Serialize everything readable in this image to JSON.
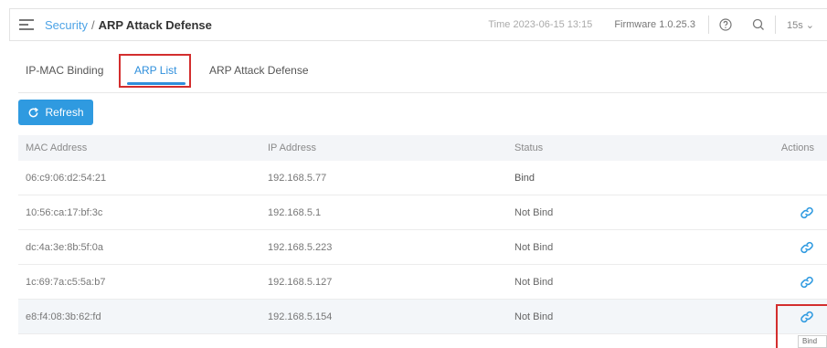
{
  "header": {
    "breadcrumb_parent": "Security",
    "breadcrumb_separator": "/",
    "breadcrumb_current": "ARP Attack Defense",
    "time": "Time 2023-06-15 13:15",
    "firmware": "Firmware 1.0.25.3",
    "refresh_interval": "15s"
  },
  "tabs": [
    {
      "label": "IP-MAC Binding",
      "active": false
    },
    {
      "label": "ARP List",
      "active": true
    },
    {
      "label": "ARP Attack Defense",
      "active": false
    }
  ],
  "toolbar": {
    "refresh_label": "Refresh"
  },
  "table": {
    "columns": [
      "MAC Address",
      "IP Address",
      "Status",
      "Actions"
    ],
    "rows": [
      {
        "mac": "06:c9:06:d2:54:21",
        "ip": "192.168.5.77",
        "status": "Bind",
        "action": ""
      },
      {
        "mac": "10:56:ca:17:bf:3c",
        "ip": "192.168.5.1",
        "status": "Not Bind",
        "action": "link-icon"
      },
      {
        "mac": "dc:4a:3e:8b:5f:0a",
        "ip": "192.168.5.223",
        "status": "Not Bind",
        "action": "link-icon"
      },
      {
        "mac": "1c:69:7a:c5:5a:b7",
        "ip": "192.168.5.127",
        "status": "Not Bind",
        "action": "link-icon"
      },
      {
        "mac": "e8:f4:08:3b:62:fd",
        "ip": "192.168.5.154",
        "status": "Not Bind",
        "action": "link-icon"
      }
    ]
  },
  "tooltip": {
    "text": "Bind"
  },
  "colors": {
    "accent": "#2f9ae0",
    "highlight": "#d32e2e"
  }
}
